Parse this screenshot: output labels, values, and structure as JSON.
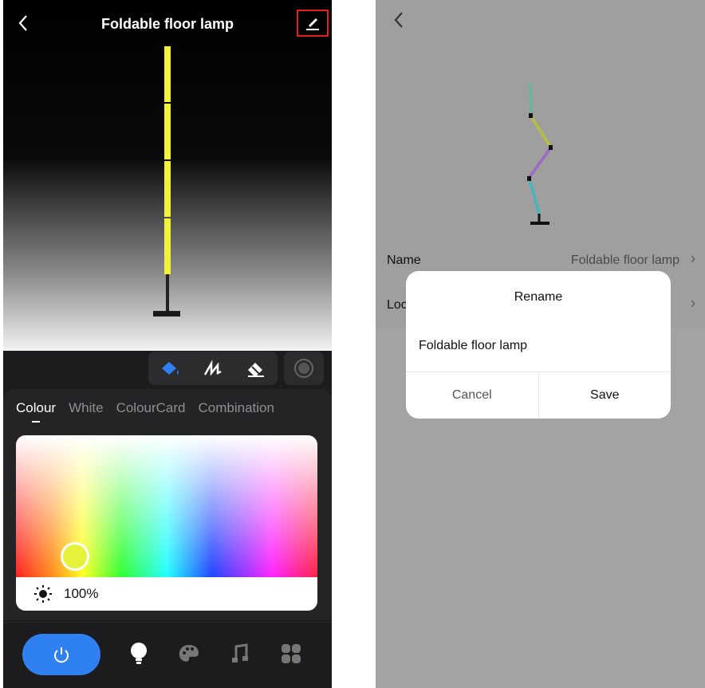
{
  "left": {
    "title": "Foldable floor lamp",
    "icons": {
      "back": "chevron-left-icon",
      "edit": "pencil-icon",
      "paint": "paint-bucket-icon",
      "draw": "brush-stroke-icon",
      "erase": "eraser-icon",
      "record": "record-icon"
    },
    "tabs": [
      {
        "label": "Colour",
        "active": true
      },
      {
        "label": "White",
        "active": false
      },
      {
        "label": "ColourCard",
        "active": false
      },
      {
        "label": "Combination",
        "active": false
      }
    ],
    "brightness_label": "100%",
    "selected_color": "#e6f23a",
    "nav": [
      "power-icon",
      "bulb-icon",
      "palette-icon",
      "music-icon",
      "scenes-grid-icon"
    ],
    "accent": "#2f80f0"
  },
  "right": {
    "rows": [
      {
        "label": "Name",
        "value": "Foldable floor lamp"
      },
      {
        "label": "Loc",
        "value": ""
      }
    ],
    "dialog": {
      "title": "Rename",
      "input_value": "Foldable floor lamp",
      "cancel_label": "Cancel",
      "save_label": "Save"
    }
  }
}
